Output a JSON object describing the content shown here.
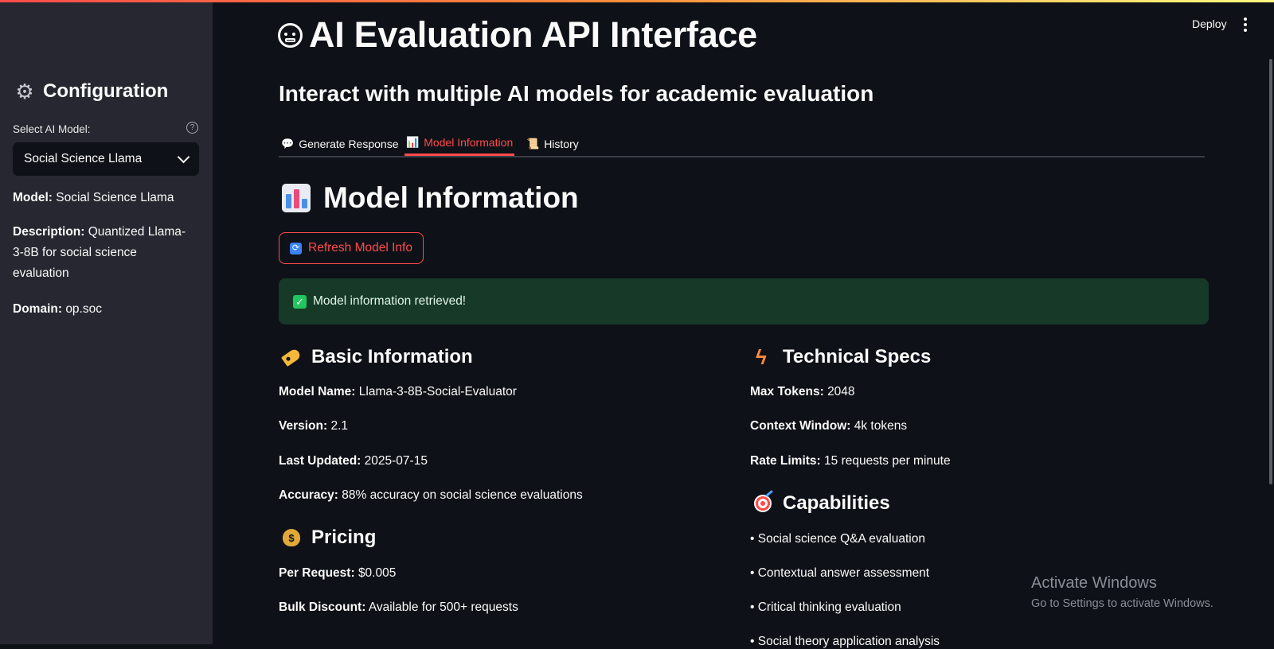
{
  "header": {
    "deploy_label": "Deploy"
  },
  "sidebar": {
    "title": "Configuration",
    "select_label": "Select AI Model:",
    "selected_model": "Social Science Llama",
    "model_label": "Model:",
    "model_value": "Social Science Llama",
    "description_label": "Description:",
    "description_value": "Quantized Llama-3-8B for social science evaluation",
    "domain_label": "Domain:",
    "domain_value": "op.soc"
  },
  "main": {
    "title": "AI Evaluation API Interface",
    "subtitle": "Interact with multiple AI models for academic evaluation",
    "tabs": [
      {
        "label": "Generate Response",
        "icon": "speech-bubble-icon",
        "active": false
      },
      {
        "label": "Model Information",
        "icon": "bar-chart-icon",
        "active": true
      },
      {
        "label": "History",
        "icon": "scroll-icon",
        "active": false
      }
    ],
    "section_title": "Model Information",
    "refresh_label": "Refresh Model Info",
    "success_message": "Model information retrieved!",
    "basic_info": {
      "title": "Basic Information",
      "items": [
        {
          "label": "Model Name:",
          "value": "Llama-3-8B-Social-Evaluator"
        },
        {
          "label": "Version:",
          "value": "2.1"
        },
        {
          "label": "Last Updated:",
          "value": "2025-07-15"
        },
        {
          "label": "Accuracy:",
          "value": "88% accuracy on social science evaluations"
        }
      ]
    },
    "pricing": {
      "title": "Pricing",
      "items": [
        {
          "label": "Per Request:",
          "value": "$0.005"
        },
        {
          "label": "Bulk Discount:",
          "value": "Available for 500+ requests"
        }
      ]
    },
    "tech_specs": {
      "title": "Technical Specs",
      "items": [
        {
          "label": "Max Tokens:",
          "value": "2048"
        },
        {
          "label": "Context Window:",
          "value": "4k tokens"
        },
        {
          "label": "Rate Limits:",
          "value": "15 requests per minute"
        }
      ]
    },
    "capabilities": {
      "title": "Capabilities",
      "items": [
        "• Social science Q&A evaluation",
        "• Contextual answer assessment",
        "• Critical thinking evaluation",
        "• Social theory application analysis"
      ]
    }
  },
  "watermark": {
    "line1": "Activate Windows",
    "line2": "Go to Settings to activate Windows."
  },
  "colors": {
    "accent": "#ff4b4b",
    "background": "#0e1117",
    "sidebar": "#262730",
    "success_bg": "#173928"
  }
}
